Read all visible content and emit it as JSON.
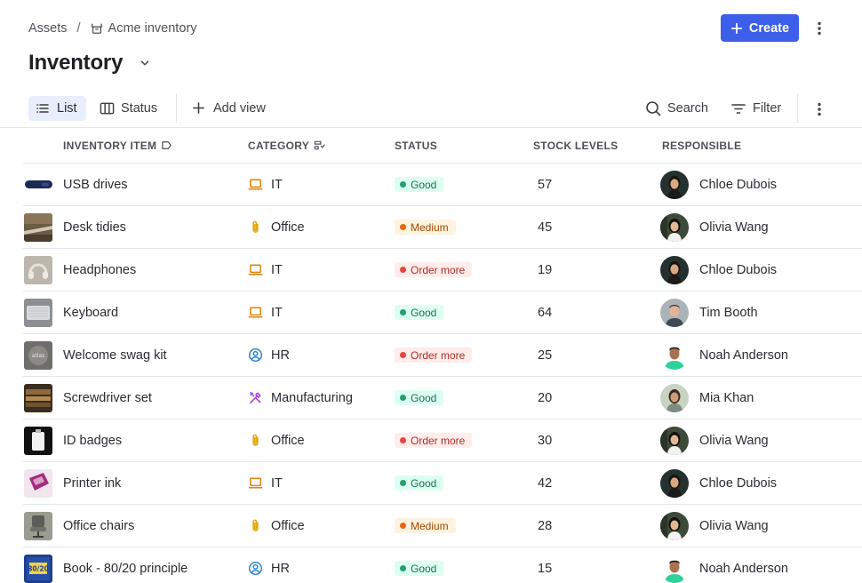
{
  "breadcrumb": {
    "root": "Assets",
    "current": "Acme inventory",
    "icon": "asset-box-icon"
  },
  "page": {
    "title": "Inventory"
  },
  "actions": {
    "create_label": "Create"
  },
  "views": [
    {
      "label": "List",
      "icon": "list-icon",
      "active": true
    },
    {
      "label": "Status",
      "icon": "columns-icon",
      "active": false
    }
  ],
  "add_view_label": "Add view",
  "tools": {
    "search_label": "Search",
    "filter_label": "Filter"
  },
  "columns": {
    "item": "Inventory item",
    "category": "Category",
    "status": "Status",
    "stock": "Stock levels",
    "responsible": "Responsible"
  },
  "status_colors": {
    "Good": "#22a06b",
    "Medium": "#e56910",
    "Order more": "#e2483d"
  },
  "rows": [
    {
      "item": "USB drives",
      "category": "IT",
      "category_icon": "laptop-icon",
      "status": "Good",
      "stock": "57",
      "responsible": "Chloe Dubois",
      "thumb": "usb"
    },
    {
      "item": "Desk tidies",
      "category": "Office",
      "category_icon": "paperclip-icon",
      "status": "Medium",
      "stock": "45",
      "responsible": "Olivia Wang",
      "thumb": "desk"
    },
    {
      "item": "Headphones",
      "category": "IT",
      "category_icon": "laptop-icon",
      "status": "Order more",
      "stock": "19",
      "responsible": "Chloe Dubois",
      "thumb": "headphones"
    },
    {
      "item": "Keyboard",
      "category": "IT",
      "category_icon": "laptop-icon",
      "status": "Good",
      "stock": "64",
      "responsible": "Tim Booth",
      "thumb": "keyboard"
    },
    {
      "item": "Welcome swag kit",
      "category": "HR",
      "category_icon": "person-circle-icon",
      "status": "Order more",
      "stock": "25",
      "responsible": "Noah Anderson",
      "thumb": "swag"
    },
    {
      "item": "Screwdriver set",
      "category": "Manufacturing",
      "category_icon": "tools-icon",
      "status": "Good",
      "stock": "20",
      "responsible": "Mia Khan",
      "thumb": "screwdriver"
    },
    {
      "item": "ID badges",
      "category": "Office",
      "category_icon": "paperclip-icon",
      "status": "Order more",
      "stock": "30",
      "responsible": "Olivia Wang",
      "thumb": "badge"
    },
    {
      "item": "Printer ink",
      "category": "IT",
      "category_icon": "laptop-icon",
      "status": "Good",
      "stock": "42",
      "responsible": "Chloe Dubois",
      "thumb": "ink"
    },
    {
      "item": "Office chairs",
      "category": "Office",
      "category_icon": "paperclip-icon",
      "status": "Medium",
      "stock": "28",
      "responsible": "Olivia Wang",
      "thumb": "chair"
    },
    {
      "item": "Book - 80/20 principle",
      "category": "HR",
      "category_icon": "person-circle-icon",
      "status": "Good",
      "stock": "15",
      "responsible": "Noah Anderson",
      "thumb": "book"
    }
  ]
}
